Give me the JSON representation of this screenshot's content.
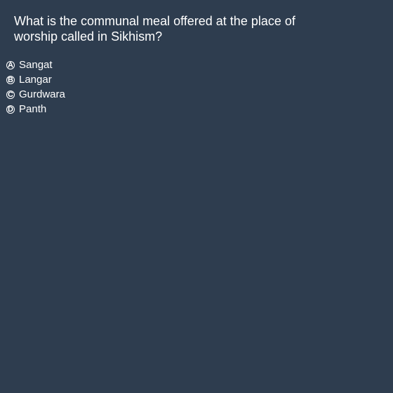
{
  "question": {
    "text": "What is the communal meal offered at the place of worship called in Sikhism?"
  },
  "options": [
    {
      "letter": "A",
      "label": "Sangat"
    },
    {
      "letter": "B",
      "label": "Langar"
    },
    {
      "letter": "C",
      "label": "Gurdwara"
    },
    {
      "letter": "D",
      "label": "Panth"
    }
  ],
  "colors": {
    "background": "#2e3d4f",
    "text": "#ffffff"
  }
}
